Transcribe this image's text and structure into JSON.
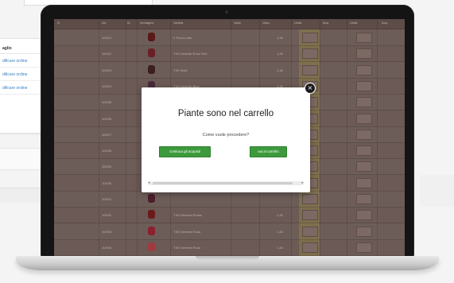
{
  "background": {
    "panel_header": "aglio",
    "panel_links": [
      "dificare ordine",
      "dificare ordine",
      "dificare ordine"
    ]
  },
  "table": {
    "columns": [
      "N",
      "Art.",
      "ID",
      "Immagine",
      "Varietà",
      "Varie",
      "Vaso",
      "Unità",
      "Acq.",
      "Unità",
      "Acq."
    ],
    "rows": [
      {
        "art": "10/021",
        "variety": "Il Trovo Letto",
        "price": "1,26",
        "thumb": "#5a1a1a"
      },
      {
        "art": "10/022",
        "variety": "T.90 Gemello Rose Red",
        "price": "1,26",
        "thumb": "#6b1f25"
      },
      {
        "art": "10/023",
        "variety": "T.90 Viola",
        "price": "1,38",
        "thumb": "#3c2020"
      },
      {
        "art": "10/024",
        "variety": "T.90 Gemello Blue",
        "price": "1,26",
        "thumb": "#4a2a3a"
      },
      {
        "art": "10/025",
        "variety": "",
        "price": "",
        "thumb": "#51202a"
      },
      {
        "art": "10/026",
        "variety": "",
        "price": "",
        "thumb": "#5c2222"
      },
      {
        "art": "10/027",
        "variety": "",
        "price": "",
        "thumb": "#4b1c22"
      },
      {
        "art": "10/028",
        "variety": "",
        "price": "",
        "thumb": "#622428"
      },
      {
        "art": "10/029",
        "variety": "",
        "price": "",
        "thumb": "#3e1e22"
      },
      {
        "art": "10/030",
        "variety": "",
        "price": "",
        "thumb": "#58201f"
      },
      {
        "art": "10/031",
        "variety": "",
        "price": "",
        "thumb": "#4d1e2c"
      },
      {
        "art": "10/032",
        "variety": "T.90 Gerbera Rossa",
        "price": "1,26",
        "thumb": "#6a1a1a"
      },
      {
        "art": "10/033",
        "variety": "T.90 Gerbera Fuxia",
        "price": "1,26",
        "thumb": "#8a2030"
      },
      {
        "art": "10/034",
        "variety": "T.90 Gerbera Rosa",
        "price": "1,26",
        "thumb": "#a03a40"
      }
    ]
  },
  "modal": {
    "title": "Piante sono nel carrello",
    "subtitle": "Come vuole procedere?",
    "continue_label": "continua gli acquisti",
    "cart_label": "vai al carrello",
    "close_symbol": "×",
    "scroll_left": "◂",
    "scroll_right": "▸"
  },
  "colors": {
    "button_green": "#3c9a3c",
    "overlay": "#6b5a55"
  }
}
